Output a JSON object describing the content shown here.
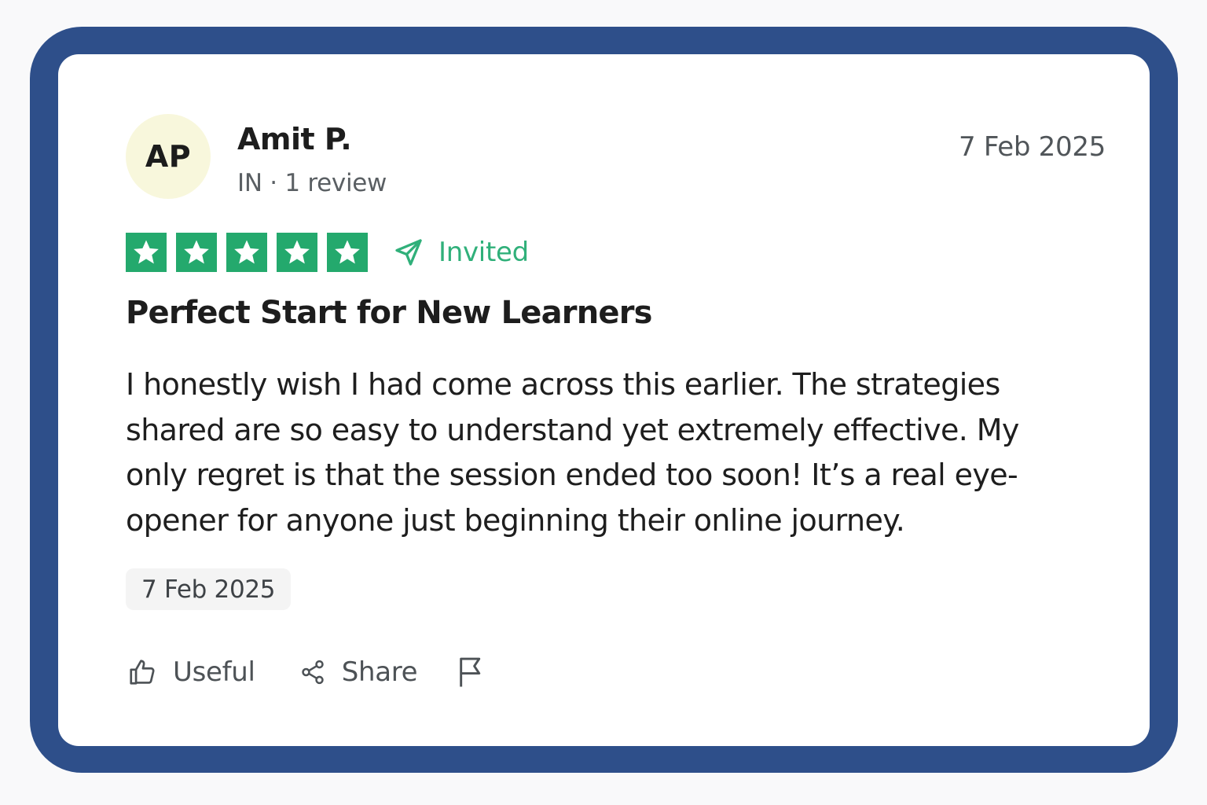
{
  "reviewer": {
    "initials": "AP",
    "name": "Amit P.",
    "meta": "IN · 1 review"
  },
  "review": {
    "date": "7 Feb 2025",
    "rating": 5,
    "rating_max": 5,
    "invited_label": "Invited",
    "title": "Perfect Start for New Learners",
    "body": "I honestly wish I had come across this earlier. The strategies shared are so easy to understand yet extremely effective. My only regret is that the session ended too soon! It’s a real eye-opener for anyone just beginning their online journey.",
    "experience_date": "7 Feb 2025"
  },
  "actions": {
    "useful_label": "Useful",
    "share_label": "Share"
  },
  "icons": {
    "useful": "thumbs-up-icon",
    "share": "share-icon",
    "report": "flag-icon",
    "invited": "paper-plane-icon",
    "star": "star-icon"
  },
  "colors": {
    "frame": "#2e4f8a",
    "star_bg": "#24a96d",
    "invited": "#30b07a",
    "avatar_bg": "#f8f7dc"
  }
}
